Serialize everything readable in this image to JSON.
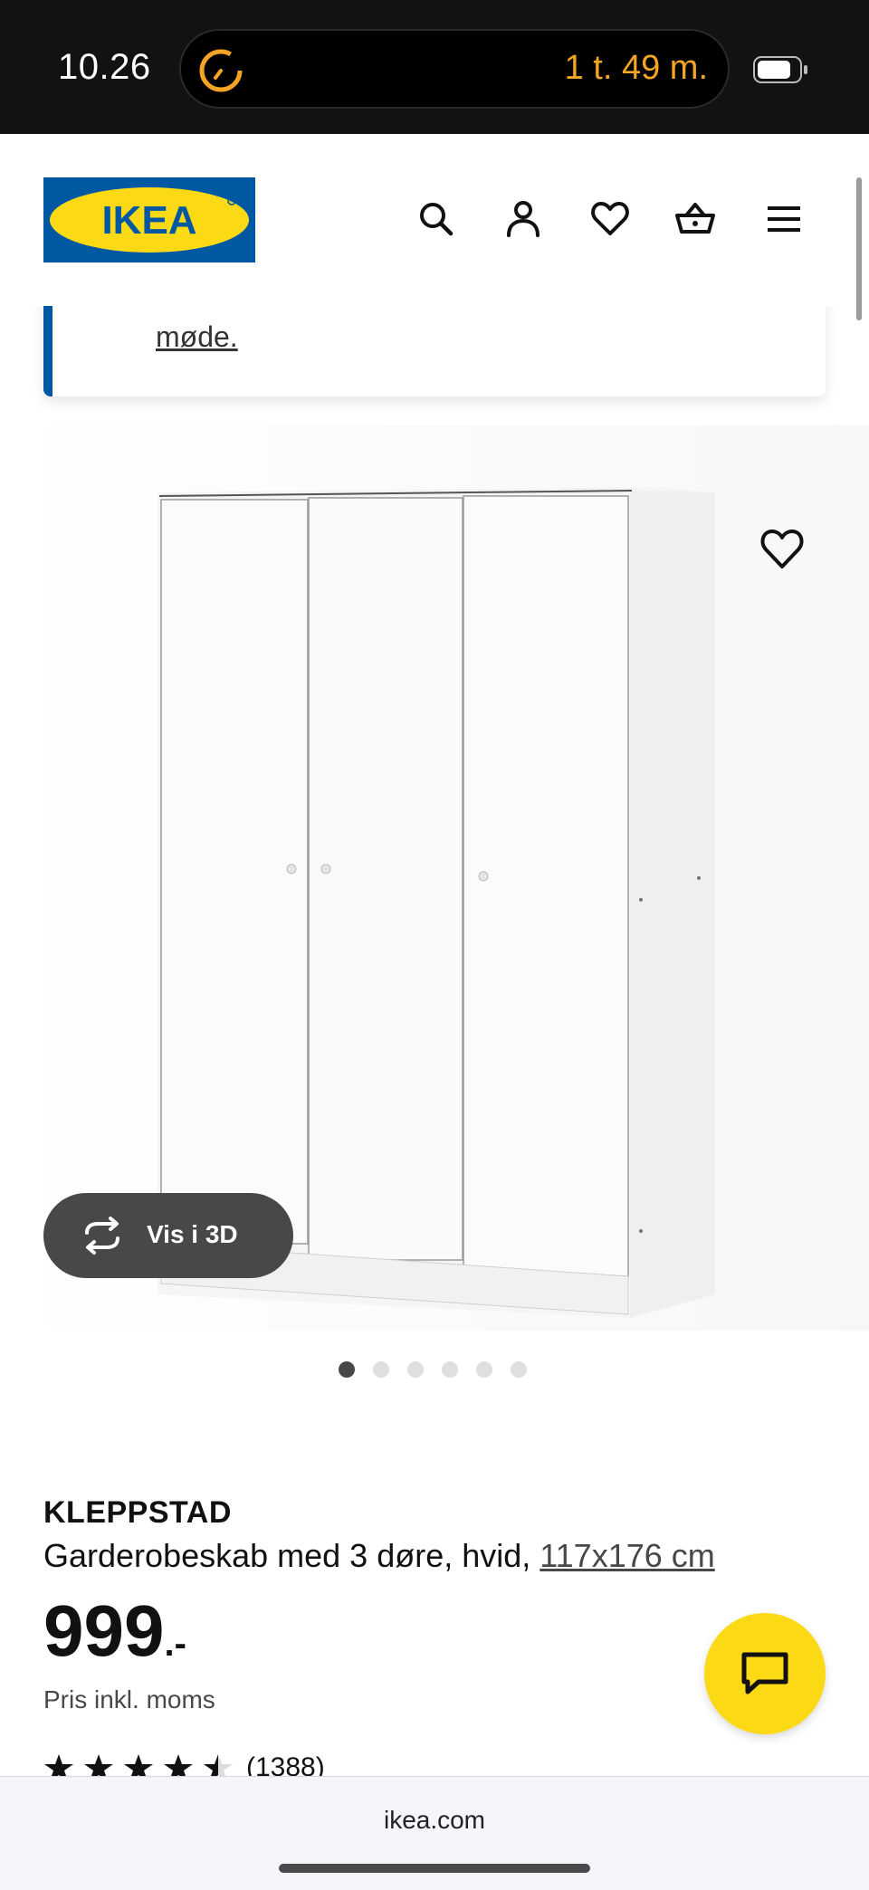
{
  "status_bar": {
    "time": "10.26",
    "timer": "1 t. 49 m."
  },
  "header": {
    "logo_text": "IKEA",
    "icons": [
      "search-icon",
      "account-icon",
      "heart-icon",
      "basket-icon",
      "menu-icon"
    ]
  },
  "notice": {
    "link_text": "møde."
  },
  "gallery": {
    "view_3d_label": "Vis i 3D",
    "dot_count": 6,
    "active_dot": 0
  },
  "product": {
    "name": "KLEPPSTAD",
    "description": "Garderobeskab med 3 døre, hvid,",
    "dimensions": "117x176 cm",
    "price": "999",
    "price_suffix": ".-",
    "price_note": "Pris inkl. moms",
    "rating": 4.5,
    "review_count": "(1388)"
  },
  "browser": {
    "url": "ikea.com"
  },
  "colors": {
    "ikea_blue": "#0058a3",
    "ikea_yellow": "#fbd914",
    "timer_orange": "#f5a524"
  }
}
